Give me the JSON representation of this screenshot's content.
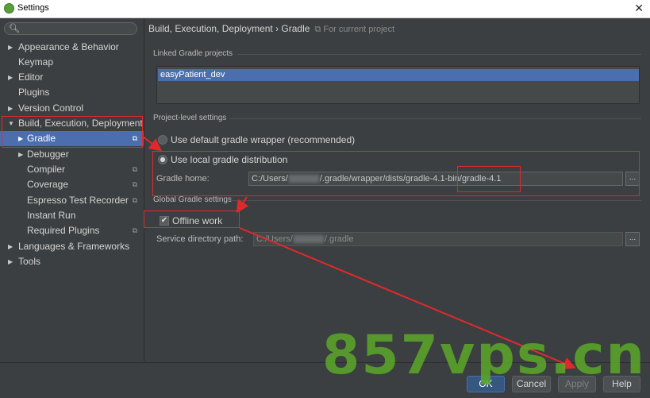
{
  "window": {
    "title": "Settings",
    "close_glyph": "✕",
    "icon": "intellij-app-icon"
  },
  "search": {
    "icon": "search-icon",
    "glyph": "🔍︎",
    "value": ""
  },
  "sidebar": {
    "items": [
      {
        "label": "Appearance & Behavior",
        "arrow": "▶",
        "project": ""
      },
      {
        "label": "Keymap",
        "arrow": "",
        "project": ""
      },
      {
        "label": "Editor",
        "arrow": "▶",
        "project": ""
      },
      {
        "label": "Plugins",
        "arrow": "",
        "project": ""
      },
      {
        "label": "Version Control",
        "arrow": "▶",
        "project": ""
      },
      {
        "label": "Build, Execution, Deployment",
        "arrow": "▼",
        "project": ""
      },
      {
        "label": "Gradle",
        "arrow": "▶",
        "project": "⧉"
      },
      {
        "label": "Debugger",
        "arrow": "▶",
        "project": ""
      },
      {
        "label": "Compiler",
        "arrow": "",
        "project": "⧉"
      },
      {
        "label": "Coverage",
        "arrow": "",
        "project": "⧉"
      },
      {
        "label": "Espresso Test Recorder",
        "arrow": "",
        "project": "⧉"
      },
      {
        "label": "Instant Run",
        "arrow": "",
        "project": ""
      },
      {
        "label": "Required Plugins",
        "arrow": "",
        "project": "⧉"
      },
      {
        "label": "Languages & Frameworks",
        "arrow": "▶",
        "project": ""
      },
      {
        "label": "Tools",
        "arrow": "▶",
        "project": ""
      }
    ],
    "selected": "Gradle"
  },
  "breadcrumb": {
    "path": "Build, Execution, Deployment › Gradle",
    "sub": "⧉ For current project"
  },
  "linked": {
    "heading": "Linked Gradle projects",
    "projects": [
      "easyPatient_dev"
    ]
  },
  "project_level": {
    "heading": "Project-level settings",
    "option_wrapper": "Use default gradle wrapper (recommended)",
    "option_local": "Use local gradle distribution",
    "gradle_home_label": "Gradle home:",
    "gradle_home_prefix": "C:/Users/",
    "gradle_home_suffix": "/.gradle/wrapper/dists/gradle-4.1-bin/gradle-4.1",
    "browse": "..."
  },
  "global": {
    "heading": "Global Gradle settings",
    "offline_label": "Offline work",
    "offline_checked": true,
    "check_glyph": "✔",
    "service_label": "Service directory path:",
    "service_prefix": "C:/Users/",
    "service_suffix": "/.gradle",
    "browse": "..."
  },
  "buttons": {
    "ok": "OK",
    "cancel": "Cancel",
    "apply": "Apply",
    "help": "Help"
  },
  "watermark": "857vps.cn",
  "colors": {
    "annotation": "#e0292d",
    "selection": "#4b6eaf",
    "background": "#3c3f41"
  }
}
